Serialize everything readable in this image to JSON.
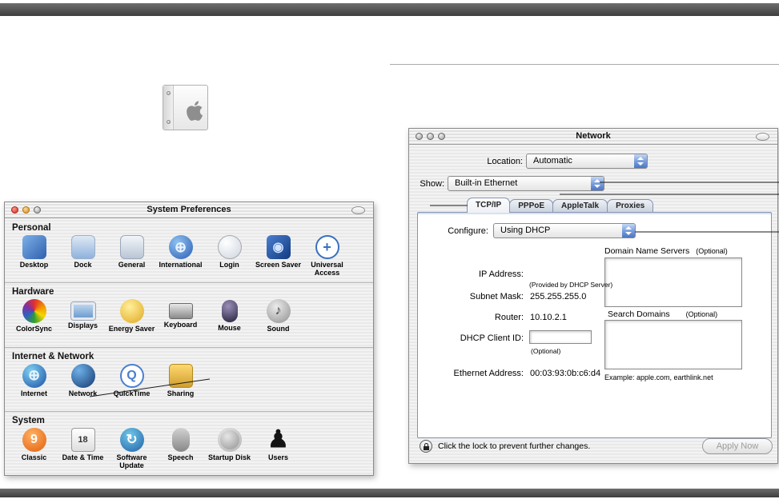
{
  "colors": {
    "aqua_blue": "#5b84c8",
    "chrome_bar_gray": "#4c4c4c",
    "pinstripe_gray": "#ececec"
  },
  "apple_icon": {
    "name": "apple-logo"
  },
  "system_preferences": {
    "title": "System Preferences",
    "sections": [
      {
        "label": "Personal",
        "items": [
          {
            "label": "Desktop",
            "icon": "desktop-icon",
            "glyph": ""
          },
          {
            "label": "Dock",
            "icon": "dock-icon",
            "glyph": ""
          },
          {
            "label": "General",
            "icon": "general-icon",
            "glyph": ""
          },
          {
            "label": "International",
            "icon": "international-icon",
            "glyph": "⊕"
          },
          {
            "label": "Login",
            "icon": "login-icon",
            "glyph": ""
          },
          {
            "label": "Screen Saver",
            "icon": "screen-saver-icon",
            "glyph": "◉"
          },
          {
            "label": "Universal Access",
            "icon": "universal-access-icon",
            "glyph": "+"
          }
        ]
      },
      {
        "label": "Hardware",
        "items": [
          {
            "label": "ColorSync",
            "icon": "colorsync-icon",
            "glyph": ""
          },
          {
            "label": "Displays",
            "icon": "displays-icon",
            "glyph": ""
          },
          {
            "label": "Energy Saver",
            "icon": "energy-saver-icon",
            "glyph": ""
          },
          {
            "label": "Keyboard",
            "icon": "keyboard-icon",
            "glyph": ""
          },
          {
            "label": "Mouse",
            "icon": "mouse-icon",
            "glyph": ""
          },
          {
            "label": "Sound",
            "icon": "sound-icon",
            "glyph": "♪"
          }
        ]
      },
      {
        "label": "Internet & Network",
        "items": [
          {
            "label": "Internet",
            "icon": "internet-icon",
            "glyph": "⊕"
          },
          {
            "label": "Network",
            "icon": "network-icon",
            "glyph": ""
          },
          {
            "label": "QuickTime",
            "icon": "quicktime-icon",
            "glyph": "Q"
          },
          {
            "label": "Sharing",
            "icon": "sharing-icon",
            "glyph": ""
          }
        ]
      },
      {
        "label": "System",
        "items": [
          {
            "label": "Classic",
            "icon": "classic-icon",
            "glyph": "9"
          },
          {
            "label": "Date & Time",
            "icon": "date-time-icon",
            "glyph": "18"
          },
          {
            "label": "Software Update",
            "icon": "software-update-icon",
            "glyph": "↻"
          },
          {
            "label": "Speech",
            "icon": "speech-icon",
            "glyph": ""
          },
          {
            "label": "Startup Disk",
            "icon": "startup-disk-icon",
            "glyph": ""
          },
          {
            "label": "Users",
            "icon": "users-icon",
            "glyph": "♟"
          }
        ]
      }
    ]
  },
  "network_window": {
    "title": "Network",
    "location_label": "Location:",
    "location_value": "Automatic",
    "show_label": "Show:",
    "show_value": "Built-in Ethernet",
    "tabs": [
      "TCP/IP",
      "PPPoE",
      "AppleTalk",
      "Proxies"
    ],
    "selected_tab": "TCP/IP",
    "configure_label": "Configure:",
    "configure_value": "Using DHCP",
    "dns_header": "Domain Name Servers",
    "dns_optional": "(Optional)",
    "ip_label": "IP Address:",
    "ip_note": "(Provided by DHCP Server)",
    "subnet_label": "Subnet Mask:",
    "subnet_value": "255.255.255.0",
    "router_label": "Router:",
    "router_value": "10.10.2.1",
    "search_domains_header": "Search Domains",
    "search_optional": "(Optional)",
    "dhcp_client_label": "DHCP Client ID:",
    "dhcp_client_value": "",
    "dhcp_client_note": "(Optional)",
    "example_text": "Example: apple.com, earthlink.net",
    "ethernet_label": "Ethernet Address:",
    "ethernet_value": "00:03:93:0b:c6:d4",
    "lock_text": "Click the lock to prevent further changes.",
    "apply_button": "Apply Now"
  }
}
